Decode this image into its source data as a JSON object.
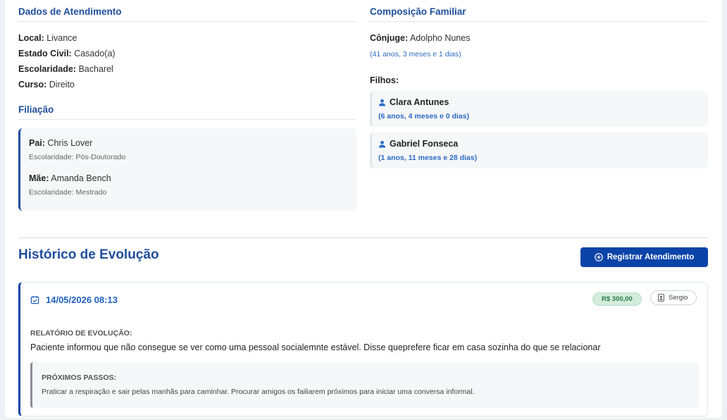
{
  "atendimento": {
    "title": "Dados de Atendimento",
    "fields": [
      {
        "label": "Local:",
        "value": "Livance"
      },
      {
        "label": "Estado Civil:",
        "value": "Casado(a)"
      },
      {
        "label": "Escolaridade:",
        "value": "Bacharel"
      },
      {
        "label": "Curso:",
        "value": "Direito"
      }
    ]
  },
  "filiacao": {
    "title": "Filiação",
    "pai": {
      "label": "Pai:",
      "name": "Chris Lover",
      "escolaridade": "Escolaridade: Pós-Doutorado"
    },
    "mae": {
      "label": "Mãe:",
      "name": "Amanda Bench",
      "escolaridade": "Escolaridade: Mestrado"
    }
  },
  "familiar": {
    "title": "Composição Familiar",
    "conjuge": {
      "label": "Cônjuge:",
      "name": "Adolpho Nunes",
      "age": "(41 anos, 3 meses e 1 dias)"
    },
    "filhos_label": "Filhos:",
    "filhos": [
      {
        "name": "Clara Antunes",
        "age": "(6 anos, 4 meses e 0 dias)"
      },
      {
        "name": "Gabriel Fonseca",
        "age": "(1 anos, 11 meses e 28 dias)"
      }
    ]
  },
  "historico": {
    "title": "Histórico de Evolução",
    "button_label": "Registrar Atendimento",
    "entries": [
      {
        "date": "14/05/2026 08:13",
        "price": "R$ 300,00",
        "user": "Sergio",
        "relatorio_label": "RELATÓRIO DE EVOLUÇÃO:",
        "relatorio_text": "Paciente informou que não consegue se ver como uma pessoal socialemnte estável. Disse queprefere ficar em casa sozinha do que se relacionar",
        "proximos_label": "PRÓXIMOS PASSOS:",
        "proximos_text": "Praticar a respiração e sair pelas manhãs para caminhar. Procurar amigos os failiarem próximos para iniciar uma conversa informal."
      }
    ]
  },
  "icons": {
    "child": "person-icon",
    "date": "calendar-check-icon",
    "button": "plus-circle-icon",
    "user": "id-badge-icon"
  },
  "colors": {
    "primary": "#1f4e9c",
    "button": "#0b44a8",
    "link": "#2a6bc4",
    "price_bg": "#d3ecdc",
    "price_text": "#2a7a48"
  }
}
